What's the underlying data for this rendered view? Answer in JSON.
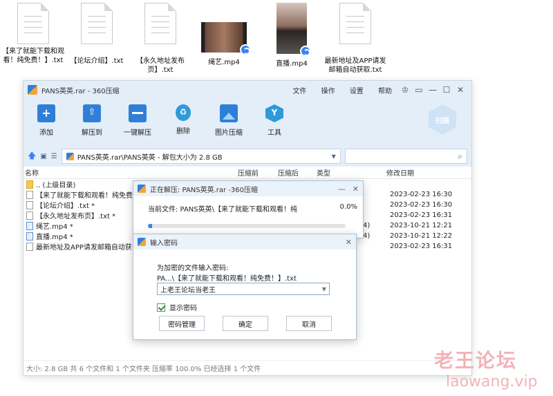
{
  "desktop": {
    "icons": [
      {
        "label": "【来了就能下载和观看！纯免费！】.txt"
      },
      {
        "label": "【论坛介绍】.txt"
      },
      {
        "label": "【永久地址发布页】.txt"
      },
      {
        "label": "绳艺.mp4"
      },
      {
        "label": "直播.mp4"
      },
      {
        "label": "最新地址及APP请发邮箱自动获取.txt"
      }
    ]
  },
  "window": {
    "title": "PANS英英.rar - 360压缩",
    "menu": [
      "文件",
      "操作",
      "设置",
      "帮助"
    ],
    "toolbar": [
      "添加",
      "解压到",
      "一键解压",
      "删除",
      "图片压缩",
      "工具"
    ],
    "scan_label": "扫描",
    "path": "PANS英英.rar\\PANS英英 - 解包大小为 2.8 GB",
    "columns": [
      "名称",
      "压缩前",
      "压缩后",
      "类型",
      "修改日期"
    ],
    "rows": [
      {
        "name": ".. (上级目录)",
        "extra": "",
        "date": ""
      },
      {
        "name": "【来了就能下载和观看！纯免费",
        "extra": "",
        "date": "2023-02-23 16:30"
      },
      {
        "name": "【论坛介绍】.txt *",
        "extra": "",
        "date": "2023-02-23 16:30"
      },
      {
        "name": "【永久地址发布页】.txt *",
        "extra": "",
        "date": "2023-02-23 16:31"
      },
      {
        "name": "绳艺.mp4 *",
        "extra": "4)",
        "date": "2023-10-21 12:21"
      },
      {
        "name": "直播.mp4 *",
        "extra": "4)",
        "date": "2023-10-21 12:22"
      },
      {
        "name": "最新地址及APP请发邮箱自动获",
        "extra": "",
        "date": "2023-02-23 16:31"
      }
    ],
    "status": "大小: 2.8 GB 共 6 个文件和 1 个文件夹 压缩率 100.0% 已经选择 1 个文件"
  },
  "extract_dialog": {
    "title": "正在解压: PANS英英.rar -360压缩",
    "current_label": "当前文件: PANS英英\\【来了就能下载和观看！纯",
    "percent": "0.0%",
    "progress_fraction": 0.02
  },
  "password_dialog": {
    "title": "输入密码",
    "prompt": "为加密的文件输入密码:",
    "file": "PA...\\【来了就能下载和观看！纯免费！】.txt",
    "password_value": "上老王论坛当老王",
    "show_password_label": "显示密码",
    "show_password_checked": true,
    "buttons": {
      "manage": "密码管理",
      "ok": "确定",
      "cancel": "取消"
    }
  },
  "watermark": {
    "cn": "老王论坛",
    "en": "laowang.vip"
  },
  "colors": {
    "accent": "#3b82f6",
    "chrome": "#e3eef8",
    "watermark": "#f2b3b8"
  }
}
